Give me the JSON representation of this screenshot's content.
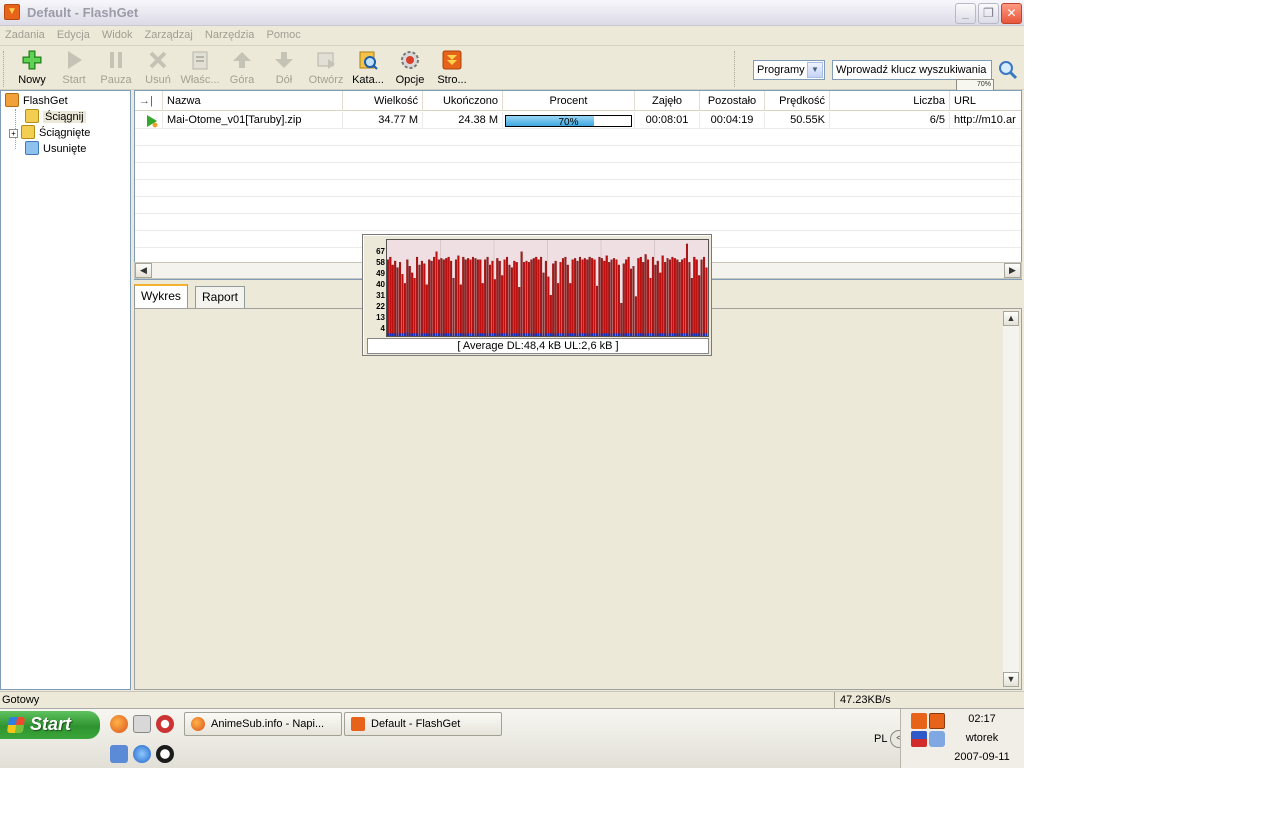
{
  "window": {
    "title": "Default - FlashGet",
    "minimize": "_",
    "restore": "❐",
    "close": "✕"
  },
  "menu": [
    "Zadania",
    "Edycja",
    "Widok",
    "Zarządzaj",
    "Narzędzia",
    "Pomoc"
  ],
  "toolbar": {
    "buttons": [
      {
        "label": "Nowy",
        "icon": "plus-icon",
        "enabled": true
      },
      {
        "label": "Start",
        "icon": "play-icon",
        "enabled": false
      },
      {
        "label": "Pauza",
        "icon": "pause-icon",
        "enabled": false
      },
      {
        "label": "Usuń",
        "icon": "delete-icon",
        "enabled": false
      },
      {
        "label": "Właśc...",
        "icon": "properties-icon",
        "enabled": false
      },
      {
        "label": "Góra",
        "icon": "arrow-up-icon",
        "enabled": false
      },
      {
        "label": "Dół",
        "icon": "arrow-down-icon",
        "enabled": false
      },
      {
        "label": "Otwórz",
        "icon": "open-icon",
        "enabled": false
      },
      {
        "label": "Kata...",
        "icon": "catalog-icon",
        "enabled": true
      },
      {
        "label": "Opcje",
        "icon": "options-icon",
        "enabled": true
      },
      {
        "label": "Stro...",
        "icon": "homepage-icon",
        "enabled": true
      }
    ],
    "programs_select": "Programy",
    "search_value": "Wprowadź klucz wyszukiwania",
    "drop_target_percent": "70%"
  },
  "tree": {
    "root": "FlashGet",
    "items": [
      "Ściągnij",
      "Ściągnięte",
      "Usunięte"
    ]
  },
  "list": {
    "columns": [
      "",
      "Nazwa",
      "Wielkość",
      "Ukończono",
      "Procent",
      "Zajęło",
      "Pozostało",
      "Prędkość",
      "Liczba",
      "URL"
    ],
    "rows": [
      {
        "name": "Mai-Otome_v01[Taruby].zip",
        "size": "34.77 M",
        "completed": "24.38 M",
        "percent": 70,
        "percent_text": "70%",
        "elapsed": "00:08:01",
        "remaining": "00:04:19",
        "speed": "50.55K",
        "count": "6/5",
        "url": "http://m10.ar"
      }
    ]
  },
  "tabs": [
    "Wykres",
    "Raport"
  ],
  "graph": {
    "y_ticks": [
      "67",
      "58",
      "49",
      "40",
      "31",
      "22",
      "13",
      "4"
    ],
    "caption": "[ Average DL:48,4 kB UL:2,6 kB ]",
    "dl_color": "#c01010",
    "ul_color": "#1030c0",
    "ymax": 70,
    "dl_values": [
      58,
      60,
      54,
      57,
      52,
      56,
      47,
      40,
      58,
      53,
      48,
      44,
      60,
      54,
      57,
      55,
      39,
      58,
      57,
      60,
      64,
      58,
      59,
      58,
      59,
      60,
      57,
      44,
      58,
      61,
      39,
      60,
      58,
      59,
      58,
      60,
      59,
      58,
      58,
      40,
      58,
      60,
      54,
      57,
      43,
      59,
      57,
      46,
      58,
      60,
      54,
      52,
      57,
      56,
      37,
      64,
      56,
      57,
      56,
      58,
      59,
      60,
      58,
      60,
      48,
      57,
      45,
      31,
      55,
      57,
      40,
      56,
      59,
      60,
      54,
      40,
      58,
      59,
      57,
      60,
      58,
      59,
      58,
      60,
      59,
      58,
      38,
      60,
      59,
      57,
      61,
      56,
      58,
      59,
      58,
      54,
      25,
      55,
      58,
      60,
      51,
      53,
      30,
      59,
      60,
      56,
      62,
      58,
      44,
      60,
      54,
      57,
      48,
      61,
      56,
      59,
      58,
      60,
      59,
      58,
      56,
      58,
      59,
      70,
      56,
      44,
      60,
      58,
      46,
      58,
      60,
      52
    ],
    "ul_values": [
      2,
      2,
      2,
      2,
      2,
      2,
      2,
      2,
      3,
      2,
      2,
      2,
      2,
      2,
      2,
      2,
      2,
      2,
      2,
      2,
      2,
      2,
      2,
      2,
      2,
      2,
      2,
      2,
      2,
      2,
      2,
      2,
      2,
      2,
      2,
      2,
      2,
      2,
      2,
      2,
      2,
      2,
      2,
      2,
      2,
      2,
      2,
      2,
      2,
      2,
      2,
      2,
      2,
      2,
      2,
      2,
      2,
      2,
      2,
      2,
      2,
      2,
      2,
      2,
      2,
      2,
      2,
      2,
      2,
      2,
      2,
      2,
      2,
      2,
      2,
      2,
      2,
      2,
      2,
      2,
      2,
      2,
      2,
      2,
      2,
      2,
      2,
      2,
      2,
      2,
      2,
      2,
      2,
      2,
      2,
      2,
      2,
      2,
      2,
      2,
      2,
      2,
      2,
      2,
      2,
      2,
      2,
      2,
      2,
      2,
      2,
      2,
      2,
      2,
      2,
      2,
      2,
      2,
      2,
      2,
      2,
      2,
      2,
      2,
      2,
      2,
      2,
      2,
      2,
      2,
      2,
      2
    ]
  },
  "status": {
    "text": "Gotowy",
    "speed": "47.23KB/s"
  },
  "taskbar": {
    "start": "Start",
    "tasks": [
      "AnimeSub.info - Napi...",
      "Default - FlashGet"
    ],
    "language": "PL",
    "time": "02:17",
    "day": "wtorek",
    "date": "2007-09-11"
  }
}
